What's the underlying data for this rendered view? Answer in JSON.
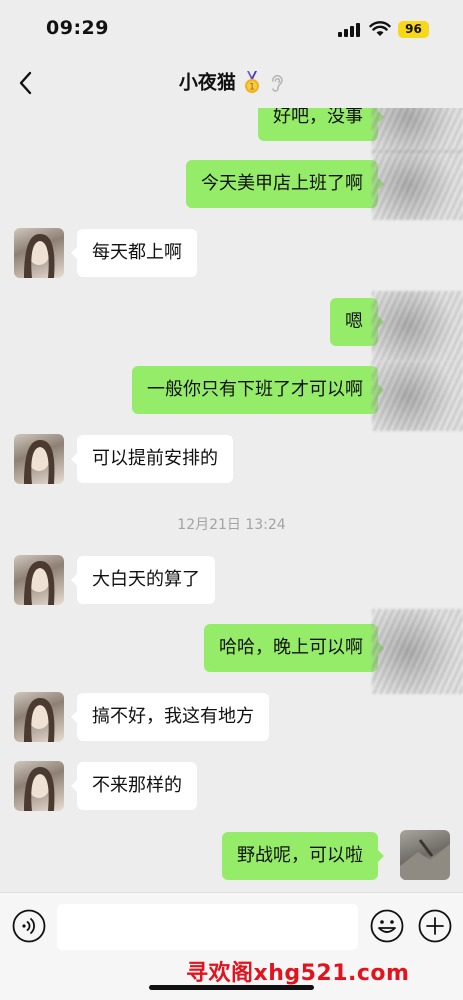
{
  "status_bar": {
    "time": "09:29",
    "battery": "96",
    "signal_icon": "cellular-signal-icon",
    "wifi_icon": "wifi-icon"
  },
  "header": {
    "title": "小夜猫",
    "back_icon": "chevron-left-icon",
    "medal_icon": "medal-icon",
    "listen_icon": "ear-icon"
  },
  "messages": [
    {
      "side": "out",
      "text": "好吧，没事"
    },
    {
      "side": "out",
      "text": "今天美甲店上班了啊"
    },
    {
      "side": "in",
      "text": "每天都上啊"
    },
    {
      "side": "out",
      "text": "嗯"
    },
    {
      "side": "out",
      "text": "一般你只有下班了才可以啊"
    },
    {
      "side": "in",
      "text": "可以提前安排的"
    },
    {
      "type": "timestamp",
      "text": "12月21日 13:24"
    },
    {
      "side": "in",
      "text": "大白天的算了"
    },
    {
      "side": "out",
      "text": "哈哈，晚上可以啊"
    },
    {
      "side": "in",
      "text": "搞不好，我这有地方"
    },
    {
      "side": "in",
      "text": "不来那样的"
    },
    {
      "side": "out",
      "text": "野战呢，可以啦"
    }
  ],
  "input_bar": {
    "voice_icon": "voice-input-icon",
    "input_value": "",
    "emoji_icon": "emoji-icon",
    "plus_icon": "plus-icon"
  },
  "watermark": "寻欢阁xhg521.com",
  "colors": {
    "background": "#ededed",
    "outgoing_bubble": "#95ec69",
    "incoming_bubble": "#ffffff",
    "watermark": "#e3121c",
    "battery": "#f6d71a"
  }
}
